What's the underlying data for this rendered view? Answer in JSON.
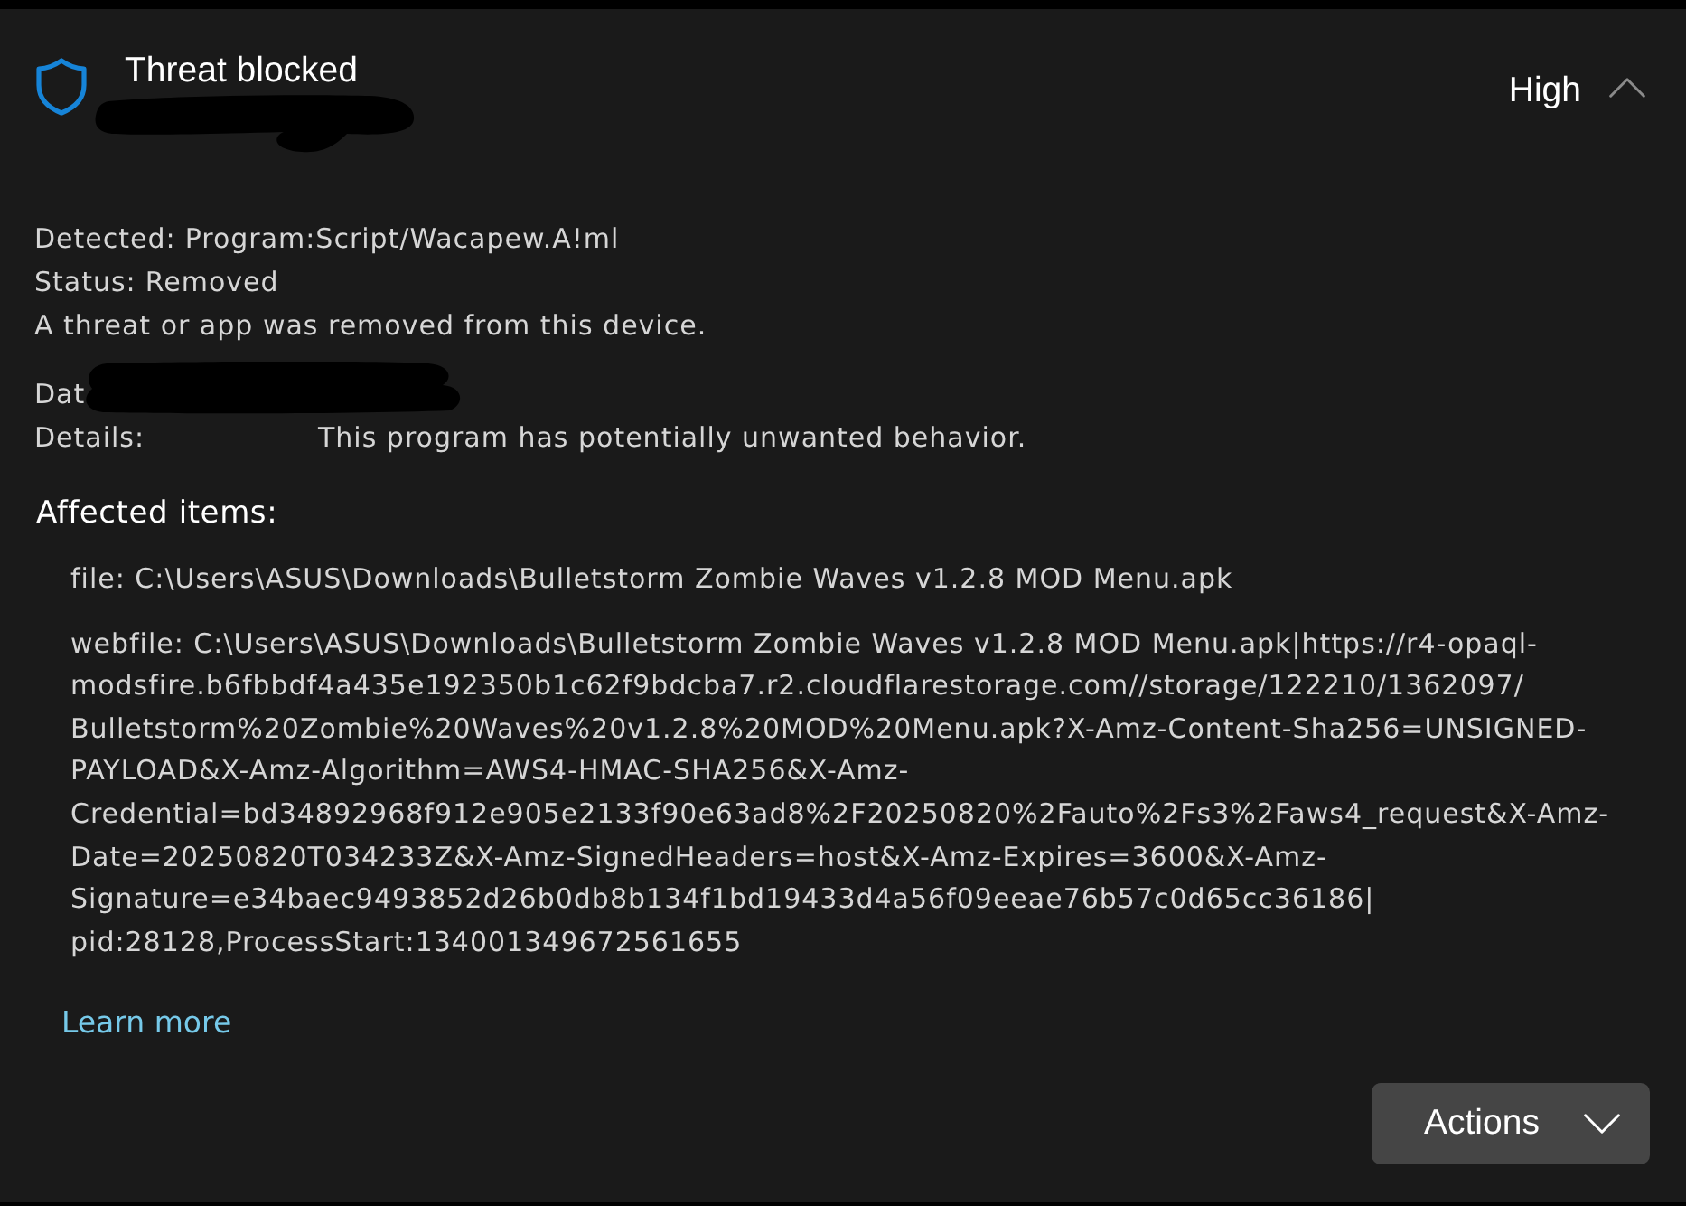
{
  "header": {
    "title": "Threat blocked",
    "severity": "High",
    "expanded": true
  },
  "summary": [
    {
      "kind": "pair",
      "label": "Detected:",
      "value": "Program:Script/Wacapew.A!ml"
    },
    {
      "kind": "pair",
      "label": "Status:",
      "value": "Removed"
    },
    {
      "kind": "text",
      "text": "A threat or app was removed from this device."
    }
  ],
  "meta": [
    {
      "kind": "redacted",
      "label": "Dat"
    },
    {
      "kind": "column",
      "label": "Details:",
      "value": "This program has potentially unwanted behavior."
    }
  ],
  "affected": {
    "heading": "Affected items:",
    "items": [
      {
        "lines": [
          "file: C:\\Users\\ASUS\\Downloads\\Bulletstorm Zombie Waves v1.2.8 MOD Menu.apk"
        ]
      },
      {
        "lines": [
          "webfile: C:\\Users\\ASUS\\Downloads\\Bulletstorm Zombie Waves v1.2.8 MOD Menu.apk|https://r4-opaql-",
          "modsfire.b6fbbdf4a435e192350b1c62f9bdcba7.r2.cloudflarestorage.com//storage/122210/1362097/",
          "Bulletstorm%20Zombie%20Waves%20v1.2.8%20MOD%20Menu.apk?X-Amz-Content-Sha256=UNSIGNED-",
          "PAYLOAD&X-Amz-Algorithm=AWS4-HMAC-SHA256&X-Amz-",
          "Credential=bd34892968f912e905e2133f90e63ad8%2F20250820%2Fauto%2Fs3%2Faws4_request&X-Amz-",
          "Date=20250820T034233Z&X-Amz-SignedHeaders=host&X-Amz-Expires=3600&X-Amz-",
          "Signature=e34baec9493852d26b0db8b134f1bd19433d4a56f09eeae76b57c0d65cc36186|",
          "pid:28128,ProcessStart:134001349672561655"
        ]
      }
    ]
  },
  "link": "Learn more",
  "actions_button": "Actions"
}
